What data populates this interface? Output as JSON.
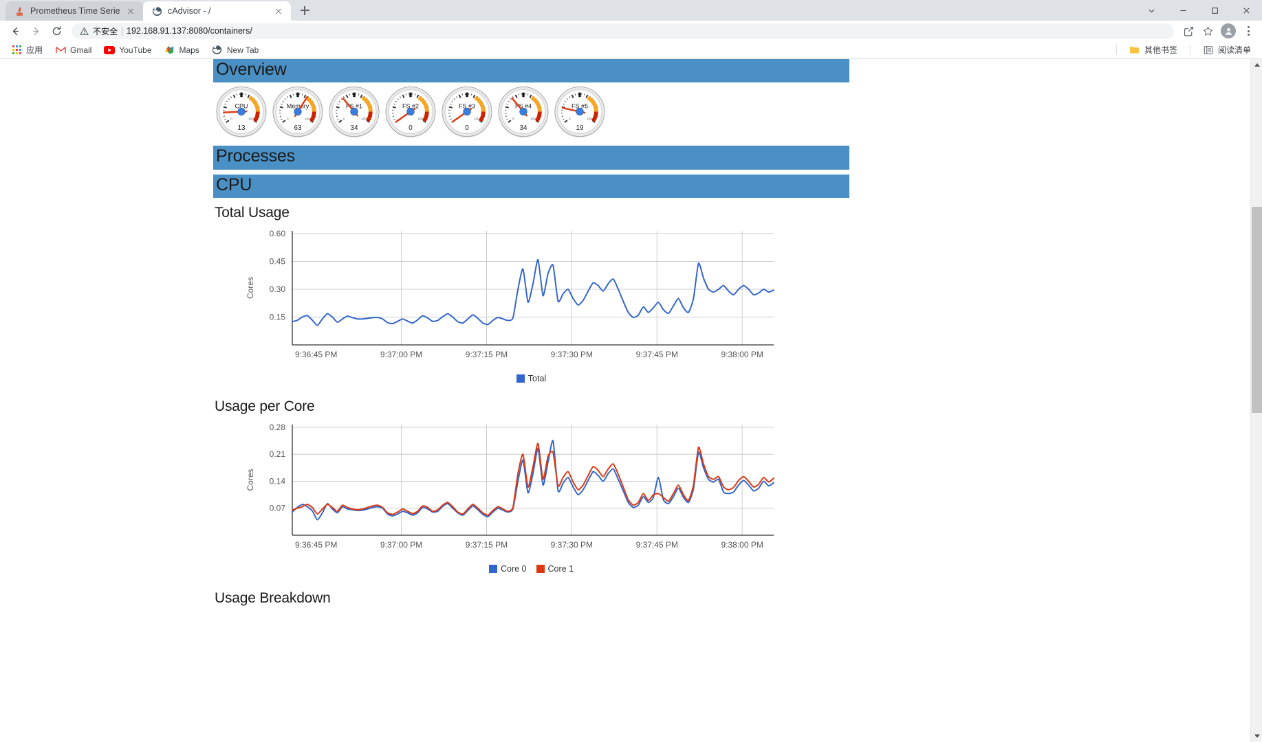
{
  "browser": {
    "tabs": [
      {
        "title": "Prometheus Time Series Colle",
        "favicon": "prometheus-icon",
        "active": false
      },
      {
        "title": "cAdvisor - /",
        "favicon": "cadvisor-globe-icon",
        "active": true
      }
    ],
    "new_tab_label": "+",
    "window_controls": {
      "minimize": "minimize",
      "maximize": "maximize",
      "close": "close",
      "chevron": "chevron-down"
    },
    "nav": {
      "back": "back-arrow",
      "forward": "forward-arrow",
      "reload": "reload-icon"
    },
    "omnibox": {
      "security_label": "不安全",
      "url": "192.168.91.137:8080/containers/",
      "url_host": "192.168.91.137:8080",
      "url_path": "/containers/"
    },
    "toolbar_icons": {
      "share": "share-icon",
      "bookmark": "star-icon",
      "profile": "avatar-icon",
      "menu": "kebab-menu-icon"
    },
    "bookmarks": [
      {
        "label": "应用",
        "icon": "apps-grid-icon"
      },
      {
        "label": "Gmail",
        "icon": "gmail-icon"
      },
      {
        "label": "YouTube",
        "icon": "youtube-icon"
      },
      {
        "label": "Maps",
        "icon": "maps-icon"
      },
      {
        "label": "New Tab",
        "icon": "globe-icon"
      }
    ],
    "bookmarks_right": [
      {
        "label": "其他书签",
        "icon": "folder-icon"
      },
      {
        "label": "阅读清单",
        "icon": "reading-list-icon"
      }
    ]
  },
  "page": {
    "sections": {
      "overview": "Overview",
      "processes": "Processes",
      "cpu": "CPU"
    },
    "gauges": [
      {
        "label": "CPU",
        "value": "13"
      },
      {
        "label": "Memory",
        "value": "63"
      },
      {
        "label": "FS #1",
        "value": "34"
      },
      {
        "label": "FS #2",
        "value": "0"
      },
      {
        "label": "FS #3",
        "value": "0"
      },
      {
        "label": "FS #4",
        "value": "34"
      },
      {
        "label": "FS #5",
        "value": "19"
      }
    ],
    "gauge_scale": {
      "min_label": "0",
      "max_label": "100"
    },
    "headings": {
      "total_usage": "Total Usage",
      "usage_per_core": "Usage per Core",
      "usage_breakdown": "Usage Breakdown"
    },
    "colors": {
      "section_header_bg": "#4a90c4",
      "series_blue": "#3366cc",
      "series_red": "#dc3912",
      "gauge_orange": "#f5a623",
      "gauge_red": "#cc2200"
    }
  },
  "chart_data": [
    {
      "type": "line",
      "title": "Total Usage",
      "ylabel": "Cores",
      "xlabel": "",
      "ylim": [
        0.0,
        0.615
      ],
      "yticks": [
        0.6,
        0.45,
        0.3,
        0.15
      ],
      "xticks": [
        "9:36:45 PM",
        "9:37:00 PM",
        "9:37:15 PM",
        "9:37:30 PM",
        "9:37:45 PM",
        "9:38:00 PM"
      ],
      "grid": true,
      "legend": [
        "Total"
      ],
      "legend_position": "bottom",
      "series": [
        {
          "name": "Total",
          "color": "#3366cc",
          "values": [
            0.125,
            0.133,
            0.15,
            0.158,
            0.133,
            0.105,
            0.14,
            0.168,
            0.15,
            0.122,
            0.14,
            0.155,
            0.147,
            0.14,
            0.14,
            0.143,
            0.147,
            0.148,
            0.14,
            0.12,
            0.115,
            0.127,
            0.14,
            0.128,
            0.118,
            0.135,
            0.157,
            0.145,
            0.127,
            0.132,
            0.152,
            0.168,
            0.15,
            0.125,
            0.118,
            0.14,
            0.162,
            0.143,
            0.118,
            0.11,
            0.132,
            0.148,
            0.14,
            0.132,
            0.145,
            0.3,
            0.41,
            0.23,
            0.33,
            0.46,
            0.265,
            0.385,
            0.43,
            0.235,
            0.275,
            0.3,
            0.25,
            0.215,
            0.24,
            0.29,
            0.335,
            0.32,
            0.29,
            0.33,
            0.355,
            0.3,
            0.235,
            0.175,
            0.148,
            0.16,
            0.205,
            0.175,
            0.2,
            0.23,
            0.19,
            0.17,
            0.21,
            0.25,
            0.2,
            0.175,
            0.25,
            0.44,
            0.36,
            0.3,
            0.285,
            0.3,
            0.32,
            0.29,
            0.27,
            0.3,
            0.32,
            0.3,
            0.27,
            0.28,
            0.3,
            0.285,
            0.295
          ]
        }
      ]
    },
    {
      "type": "line",
      "title": "Usage per Core",
      "ylabel": "Cores",
      "xlabel": "",
      "ylim": [
        0.0,
        0.287
      ],
      "yticks": [
        0.28,
        0.21,
        0.14,
        0.07
      ],
      "xticks": [
        "9:36:45 PM",
        "9:37:00 PM",
        "9:37:15 PM",
        "9:37:30 PM",
        "9:37:45 PM",
        "9:38:00 PM"
      ],
      "grid": true,
      "legend": [
        "Core 0",
        "Core 1"
      ],
      "legend_position": "bottom",
      "series": [
        {
          "name": "Core 0",
          "color": "#3366cc",
          "values": [
            0.06,
            0.072,
            0.08,
            0.074,
            0.063,
            0.04,
            0.058,
            0.082,
            0.068,
            0.058,
            0.074,
            0.068,
            0.066,
            0.064,
            0.065,
            0.068,
            0.072,
            0.074,
            0.07,
            0.055,
            0.05,
            0.055,
            0.062,
            0.058,
            0.052,
            0.058,
            0.072,
            0.068,
            0.06,
            0.062,
            0.075,
            0.082,
            0.07,
            0.058,
            0.052,
            0.064,
            0.076,
            0.066,
            0.054,
            0.048,
            0.06,
            0.07,
            0.065,
            0.06,
            0.068,
            0.14,
            0.195,
            0.11,
            0.16,
            0.225,
            0.13,
            0.19,
            0.245,
            0.115,
            0.135,
            0.15,
            0.125,
            0.105,
            0.118,
            0.142,
            0.165,
            0.155,
            0.14,
            0.16,
            0.172,
            0.145,
            0.115,
            0.085,
            0.072,
            0.078,
            0.1,
            0.085,
            0.098,
            0.15,
            0.092,
            0.082,
            0.1,
            0.122,
            0.098,
            0.085,
            0.12,
            0.215,
            0.175,
            0.145,
            0.138,
            0.145,
            0.112,
            0.108,
            0.112,
            0.13,
            0.142,
            0.13,
            0.115,
            0.122,
            0.14,
            0.128,
            0.136
          ]
        },
        {
          "name": "Core 1",
          "color": "#dc3912",
          "values": [
            0.065,
            0.07,
            0.074,
            0.08,
            0.072,
            0.055,
            0.068,
            0.08,
            0.072,
            0.062,
            0.078,
            0.072,
            0.068,
            0.066,
            0.068,
            0.072,
            0.076,
            0.078,
            0.072,
            0.058,
            0.054,
            0.06,
            0.068,
            0.062,
            0.056,
            0.062,
            0.076,
            0.072,
            0.062,
            0.066,
            0.078,
            0.085,
            0.074,
            0.06,
            0.055,
            0.068,
            0.08,
            0.07,
            0.058,
            0.052,
            0.064,
            0.074,
            0.068,
            0.062,
            0.072,
            0.16,
            0.21,
            0.125,
            0.178,
            0.238,
            0.145,
            0.205,
            0.215,
            0.128,
            0.15,
            0.165,
            0.138,
            0.118,
            0.13,
            0.155,
            0.178,
            0.168,
            0.152,
            0.172,
            0.185,
            0.158,
            0.125,
            0.092,
            0.078,
            0.085,
            0.108,
            0.09,
            0.105,
            0.108,
            0.098,
            0.088,
            0.108,
            0.13,
            0.105,
            0.09,
            0.13,
            0.228,
            0.185,
            0.152,
            0.145,
            0.152,
            0.125,
            0.118,
            0.124,
            0.142,
            0.152,
            0.14,
            0.125,
            0.132,
            0.15,
            0.138,
            0.148
          ]
        }
      ]
    }
  ]
}
